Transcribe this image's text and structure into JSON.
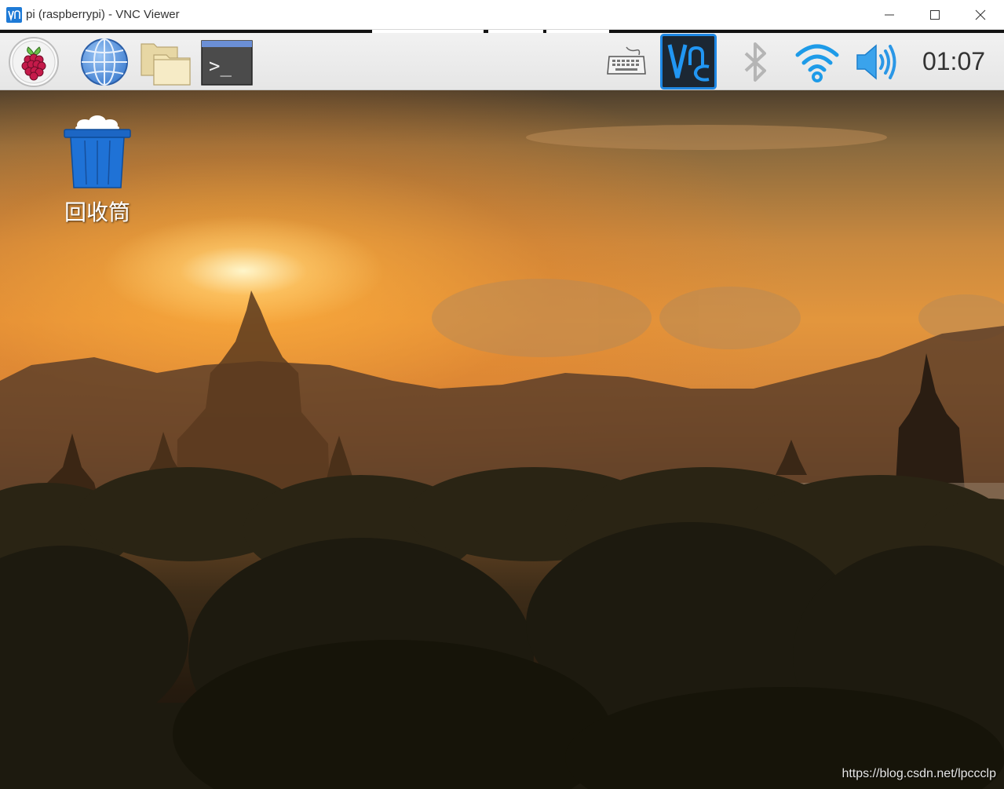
{
  "window": {
    "title": "pi (raspberrypi) - VNC Viewer",
    "app_icon": "vnc-viewer-icon",
    "controls": [
      "minimize-icon",
      "maximize-icon",
      "close-icon"
    ]
  },
  "panel": {
    "launchers": [
      {
        "name": "raspberry-menu",
        "icon": "raspberry-icon"
      },
      {
        "name": "web-browser",
        "icon": "globe-icon"
      },
      {
        "name": "file-manager",
        "icon": "folder-icon"
      },
      {
        "name": "terminal",
        "icon": "terminal-icon"
      }
    ],
    "tray": [
      {
        "name": "virtual-keyboard",
        "icon": "keyboard-icon"
      },
      {
        "name": "vnc-server",
        "icon": "vnc-icon"
      },
      {
        "name": "bluetooth",
        "icon": "bluetooth-icon"
      },
      {
        "name": "wifi",
        "icon": "wifi-icon"
      },
      {
        "name": "volume",
        "icon": "speaker-icon"
      }
    ],
    "terminal_prompt": ">_",
    "clock": "01:07"
  },
  "desktop": {
    "trash_label": "回收筒",
    "watermark": "https://blog.csdn.net/lpccclp"
  },
  "colors": {
    "accent_blue": "#1e88e5",
    "vnc_tile": "#1c2733",
    "raspberry_red": "#c51a4a"
  }
}
